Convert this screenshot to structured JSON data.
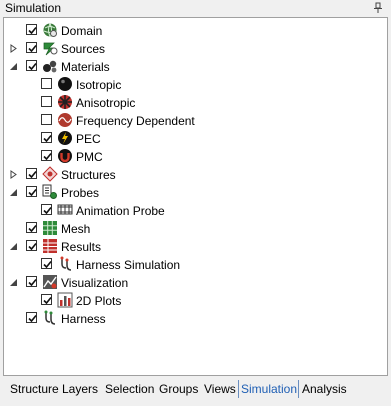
{
  "panel": {
    "title": "Simulation"
  },
  "tree": [
    {
      "label": "Domain",
      "checked": true,
      "expander": "",
      "level": 0,
      "icon": "domain-icon"
    },
    {
      "label": "Sources",
      "checked": true,
      "expander": "collapsed",
      "level": 0,
      "icon": "sources-icon"
    },
    {
      "label": "Materials",
      "checked": true,
      "expander": "expanded",
      "level": 0,
      "icon": "materials-icon"
    },
    {
      "label": "Isotropic",
      "checked": false,
      "expander": "",
      "level": 1,
      "icon": "isotropic-icon"
    },
    {
      "label": "Anisotropic",
      "checked": false,
      "expander": "",
      "level": 1,
      "icon": "anisotropic-icon"
    },
    {
      "label": "Frequency Dependent",
      "checked": false,
      "expander": "",
      "level": 1,
      "icon": "frequency-dependent-icon"
    },
    {
      "label": "PEC",
      "checked": true,
      "expander": "",
      "level": 1,
      "icon": "pec-icon"
    },
    {
      "label": "PMC",
      "checked": true,
      "expander": "",
      "level": 1,
      "icon": "pmc-icon"
    },
    {
      "label": "Structures",
      "checked": true,
      "expander": "collapsed",
      "level": 0,
      "icon": "structures-icon"
    },
    {
      "label": "Probes",
      "checked": true,
      "expander": "expanded",
      "level": 0,
      "icon": "probes-icon"
    },
    {
      "label": "Animation Probe",
      "checked": true,
      "expander": "",
      "level": 1,
      "icon": "animation-probe-icon"
    },
    {
      "label": "Mesh",
      "checked": true,
      "expander": "",
      "level": 0,
      "icon": "mesh-icon"
    },
    {
      "label": "Results",
      "checked": true,
      "expander": "expanded",
      "level": 0,
      "icon": "results-icon"
    },
    {
      "label": "Harness Simulation",
      "checked": true,
      "expander": "",
      "level": 1,
      "icon": "harness-simulation-icon"
    },
    {
      "label": "Visualization",
      "checked": true,
      "expander": "expanded",
      "level": 0,
      "icon": "visualization-icon"
    },
    {
      "label": "2D Plots",
      "checked": true,
      "expander": "",
      "level": 1,
      "icon": "plots-2d-icon"
    },
    {
      "label": "Harness",
      "checked": true,
      "expander": "",
      "level": 0,
      "icon": "harness-icon"
    }
  ],
  "tabs": [
    "Structure",
    "Layers",
    "Selection",
    "Groups",
    "Views",
    "Simulation",
    "Analysis"
  ],
  "active_tab": "Simulation",
  "colors": {
    "accent": "#1f5fb4",
    "border": "#a0a0a0",
    "background": "#f0f0f0"
  }
}
